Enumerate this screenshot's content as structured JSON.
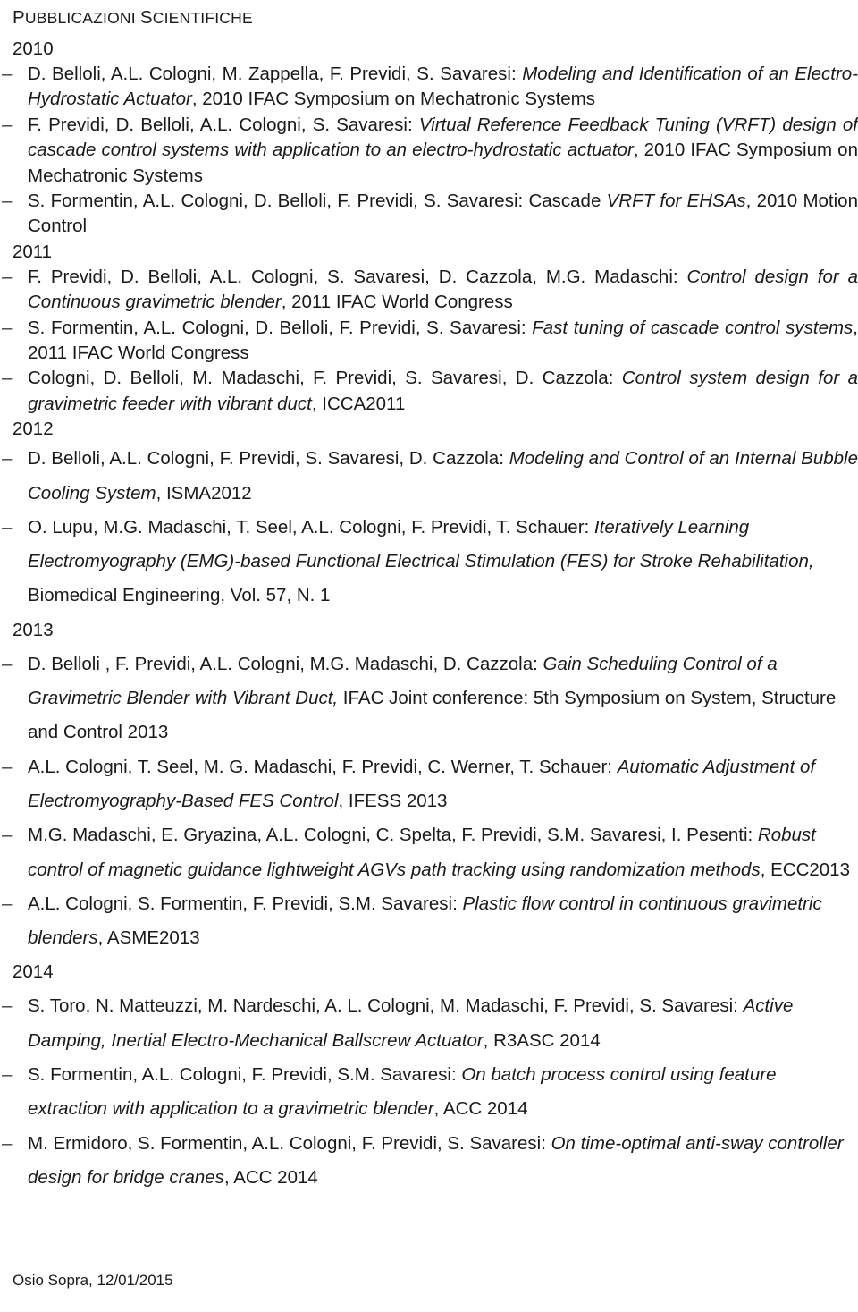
{
  "document": {
    "title_first_letter": "P",
    "title_rest": "UBBLICAZIONI ",
    "title_second_letter": "S",
    "title_rest2": "CIENTIFICHE",
    "title_full": "PUBBLICAZIONI SCIENTIFICHE",
    "bullet_glyph": "–",
    "text_color": "#1a1a1a",
    "background_color": "#ffffff"
  },
  "sections": [
    {
      "year": "2010",
      "entries": [
        {
          "authors": "D. Belloli, A.L. Cologni, M. Zappella, F. Previdi, S. Savaresi: ",
          "title": "Modeling and Identification of an Electro-Hydrostatic Actuator",
          "venue": ", 2010 IFAC Symposium on Mechatronic Systems"
        },
        {
          "authors": "F. Previdi, D. Belloli, A.L. Cologni, S. Savaresi: ",
          "title": "Virtual Reference Feedback Tuning (VRFT) design of cascade control systems with application to an electro-hydrostatic actuator",
          "venue": ", 2010 IFAC Symposium on Mechatronic Systems"
        },
        {
          "authors": "S. Formentin, A.L. Cologni, D. Belloli, F. Previdi, S. Savaresi: Cascade ",
          "title": "VRFT for EHSAs",
          "venue": ", 2010 Motion Control"
        }
      ]
    },
    {
      "year": "2011",
      "entries": [
        {
          "authors": "F. Previdi, D. Belloli, A.L. Cologni, S. Savaresi, D. Cazzola, M.G. Madaschi: ",
          "title": "Control design for a Continuous gravimetric blender",
          "venue": ", 2011 IFAC World Congress"
        },
        {
          "authors": "S. Formentin, A.L. Cologni, D. Belloli, F. Previdi, S. Savaresi: ",
          "title": "Fast tuning of cascade control systems",
          "venue": ", 2011 IFAC World Congress"
        },
        {
          "authors": "Cologni, D. Belloli, M. Madaschi, F. Previdi, S. Savaresi, D. Cazzola: ",
          "title": "Control system design for a gravimetric feeder with vibrant duct",
          "venue": ", ICCA2011"
        }
      ]
    },
    {
      "year": "2012",
      "entries": [
        {
          "authors": "D. Belloli, A.L. Cologni, F. Previdi, S. Savaresi, D. Cazzola: ",
          "title": "Modeling and Control of an Internal Bubble Cooling System",
          "venue": ", ISMA2012"
        },
        {
          "authors": "O. Lupu, M.G. Madaschi, T. Seel, A.L. Cologni, F. Previdi, T. Schauer: ",
          "title": "Iteratively Learning Electromyography (EMG)-based Functional Electrical Stimulation (FES) for Stroke Rehabilitation,",
          "venue": " Biomedical Engineering, Vol. 57, N. 1"
        }
      ]
    },
    {
      "year": "2013",
      "entries": [
        {
          "authors": "D. Belloli , F. Previdi, A.L. Cologni, M.G. Madaschi, D. Cazzola: ",
          "title": "Gain Scheduling Control of a Gravimetric Blender with Vibrant Duct,",
          "venue": " IFAC Joint conference: 5th Symposium on System, Structure and Control 2013"
        },
        {
          "authors": "A.L. Cologni, T. Seel, M. G. Madaschi, F. Previdi, C. Werner, T. Schauer: ",
          "title": "Automatic Adjustment of Electromyography-Based FES Control",
          "venue": ", IFESS 2013"
        },
        {
          "authors": "M.G. Madaschi, E. Gryazina, A.L. Cologni, C. Spelta, F. Previdi, S.M. Savaresi, I. Pesenti: ",
          "title": "Robust control of magnetic guidance lightweight AGVs path tracking using randomization methods",
          "venue": ", ECC2013"
        },
        {
          "authors": "A.L. Cologni, S. Formentin, F. Previdi, S.M. Savaresi: ",
          "title": "Plastic flow control in continuous gravimetric blenders",
          "venue": ", ASME2013"
        }
      ]
    },
    {
      "year": "2014",
      "entries": [
        {
          "authors": "S. Toro, N. Matteuzzi, M. Nardeschi, A. L. Cologni, M. Madaschi, F. Previdi, S. Savaresi: ",
          "title": "Active Damping, Inertial Electro-Mechanical Ballscrew Actuator",
          "venue": ", R3ASC 2014"
        },
        {
          "authors": "S. Formentin, A.L. Cologni, F. Previdi, S.M. Savaresi: ",
          "title": "On batch process control using feature extraction with application to a gravimetric blender",
          "venue": ", ACC 2014"
        },
        {
          "authors": "M. Ermidoro, S. Formentin, A.L. Cologni, F. Previdi, S. Savaresi: ",
          "title": "On time-optimal anti-sway controller design for bridge cranes",
          "venue": ", ACC 2014"
        }
      ]
    }
  ],
  "footer": {
    "text": "Osio Sopra, 12/01/2015"
  }
}
